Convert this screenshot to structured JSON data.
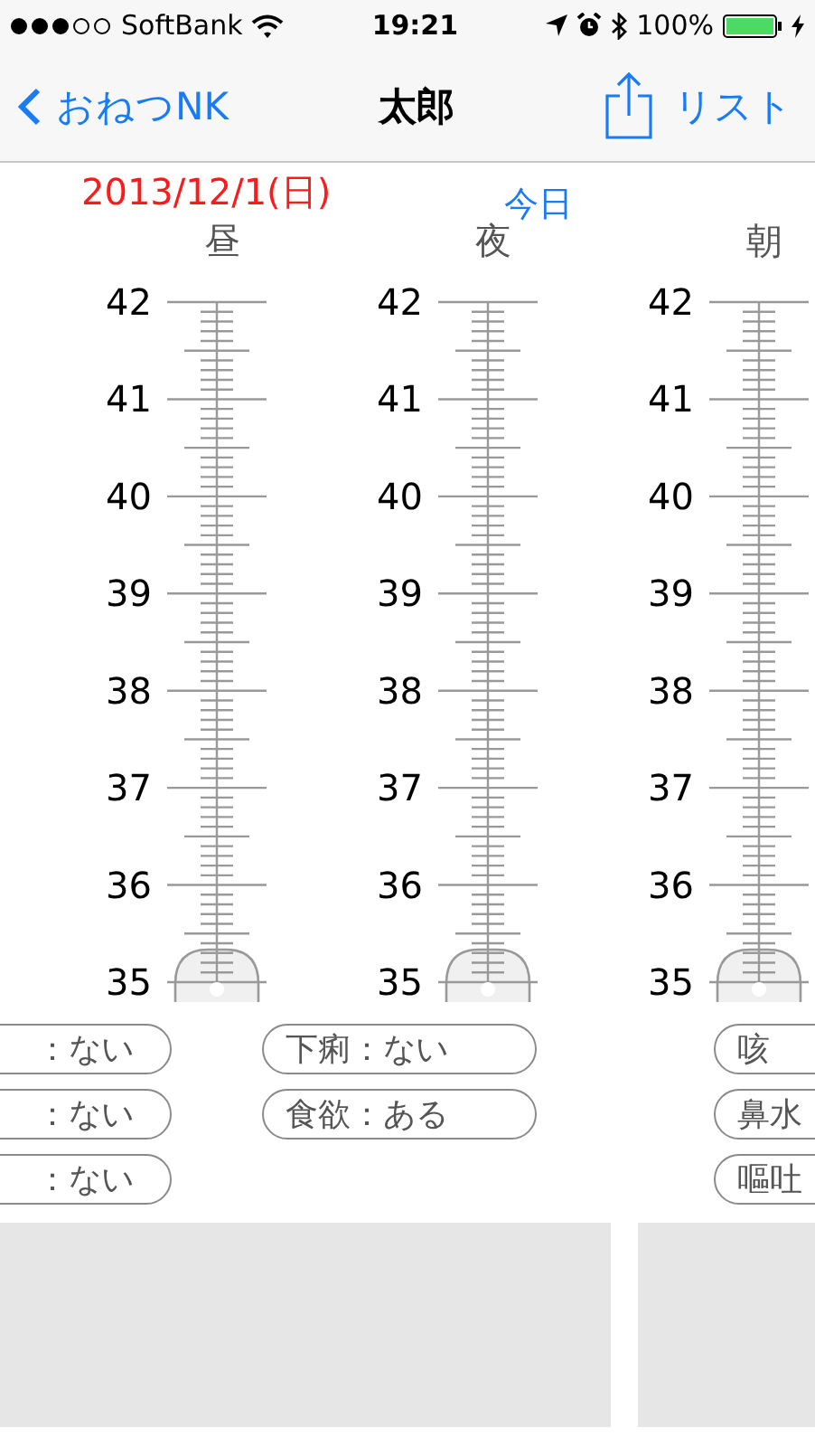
{
  "status_bar": {
    "carrier": "SoftBank",
    "time": "19:21",
    "battery": "100%"
  },
  "nav": {
    "back": "おねつNK",
    "title": "太郎",
    "action": "リスト"
  },
  "date": "2013/12/1(日)",
  "today": "今日",
  "columns": [
    {
      "label": "昼",
      "scale": [
        "42",
        "41",
        "40",
        "39",
        "38",
        "37",
        "36",
        "35"
      ]
    },
    {
      "label": "夜",
      "scale": [
        "42",
        "41",
        "40",
        "39",
        "38",
        "37",
        "36",
        "35"
      ]
    },
    {
      "label": "朝",
      "scale": [
        "42",
        "41",
        "40",
        "39",
        "38",
        "37",
        "36",
        "35"
      ]
    }
  ],
  "symptom_groups": [
    {
      "kind": "cut-left",
      "items": [
        "：ない",
        "：ない",
        "：ない"
      ]
    },
    {
      "kind": "full",
      "items": [
        "下痢：ない",
        "食欲：ある"
      ]
    },
    {
      "kind": "cut-right",
      "items": [
        "咳",
        "鼻水",
        "嘔吐"
      ]
    }
  ]
}
